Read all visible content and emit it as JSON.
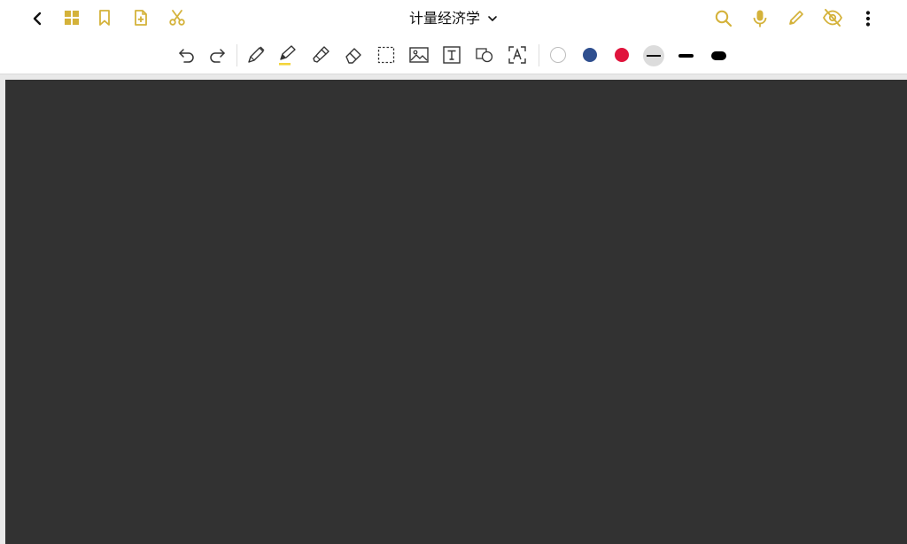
{
  "header": {
    "title": "计量经济学",
    "icons": {
      "back": "chevron-left-icon",
      "grid": "grid-icon",
      "bookmark": "bookmark-icon",
      "add_page": "file-plus-icon",
      "scissors": "scissors-icon",
      "title_dropdown": "chevron-down-icon",
      "search": "search-icon",
      "mic": "microphone-icon",
      "pen": "pencil-icon",
      "hide": "eye-off-icon",
      "more": "more-vertical-icon"
    }
  },
  "toolbar": {
    "tools": [
      "undo",
      "redo",
      "pen",
      "highlighter",
      "marker",
      "eraser",
      "lasso-select",
      "image",
      "text-box",
      "shapes",
      "ocr-text"
    ],
    "colors": {
      "accent": "#d4b23a",
      "swatch_white": "#ffffff",
      "swatch_navy": "#2f4f8f",
      "swatch_red": "#e0143c",
      "highlight_yellow": "#f3d43b",
      "canvas": "#323232"
    },
    "stroke_widths": [
      "thin",
      "medium",
      "thick"
    ],
    "selected_stroke": "thin"
  }
}
